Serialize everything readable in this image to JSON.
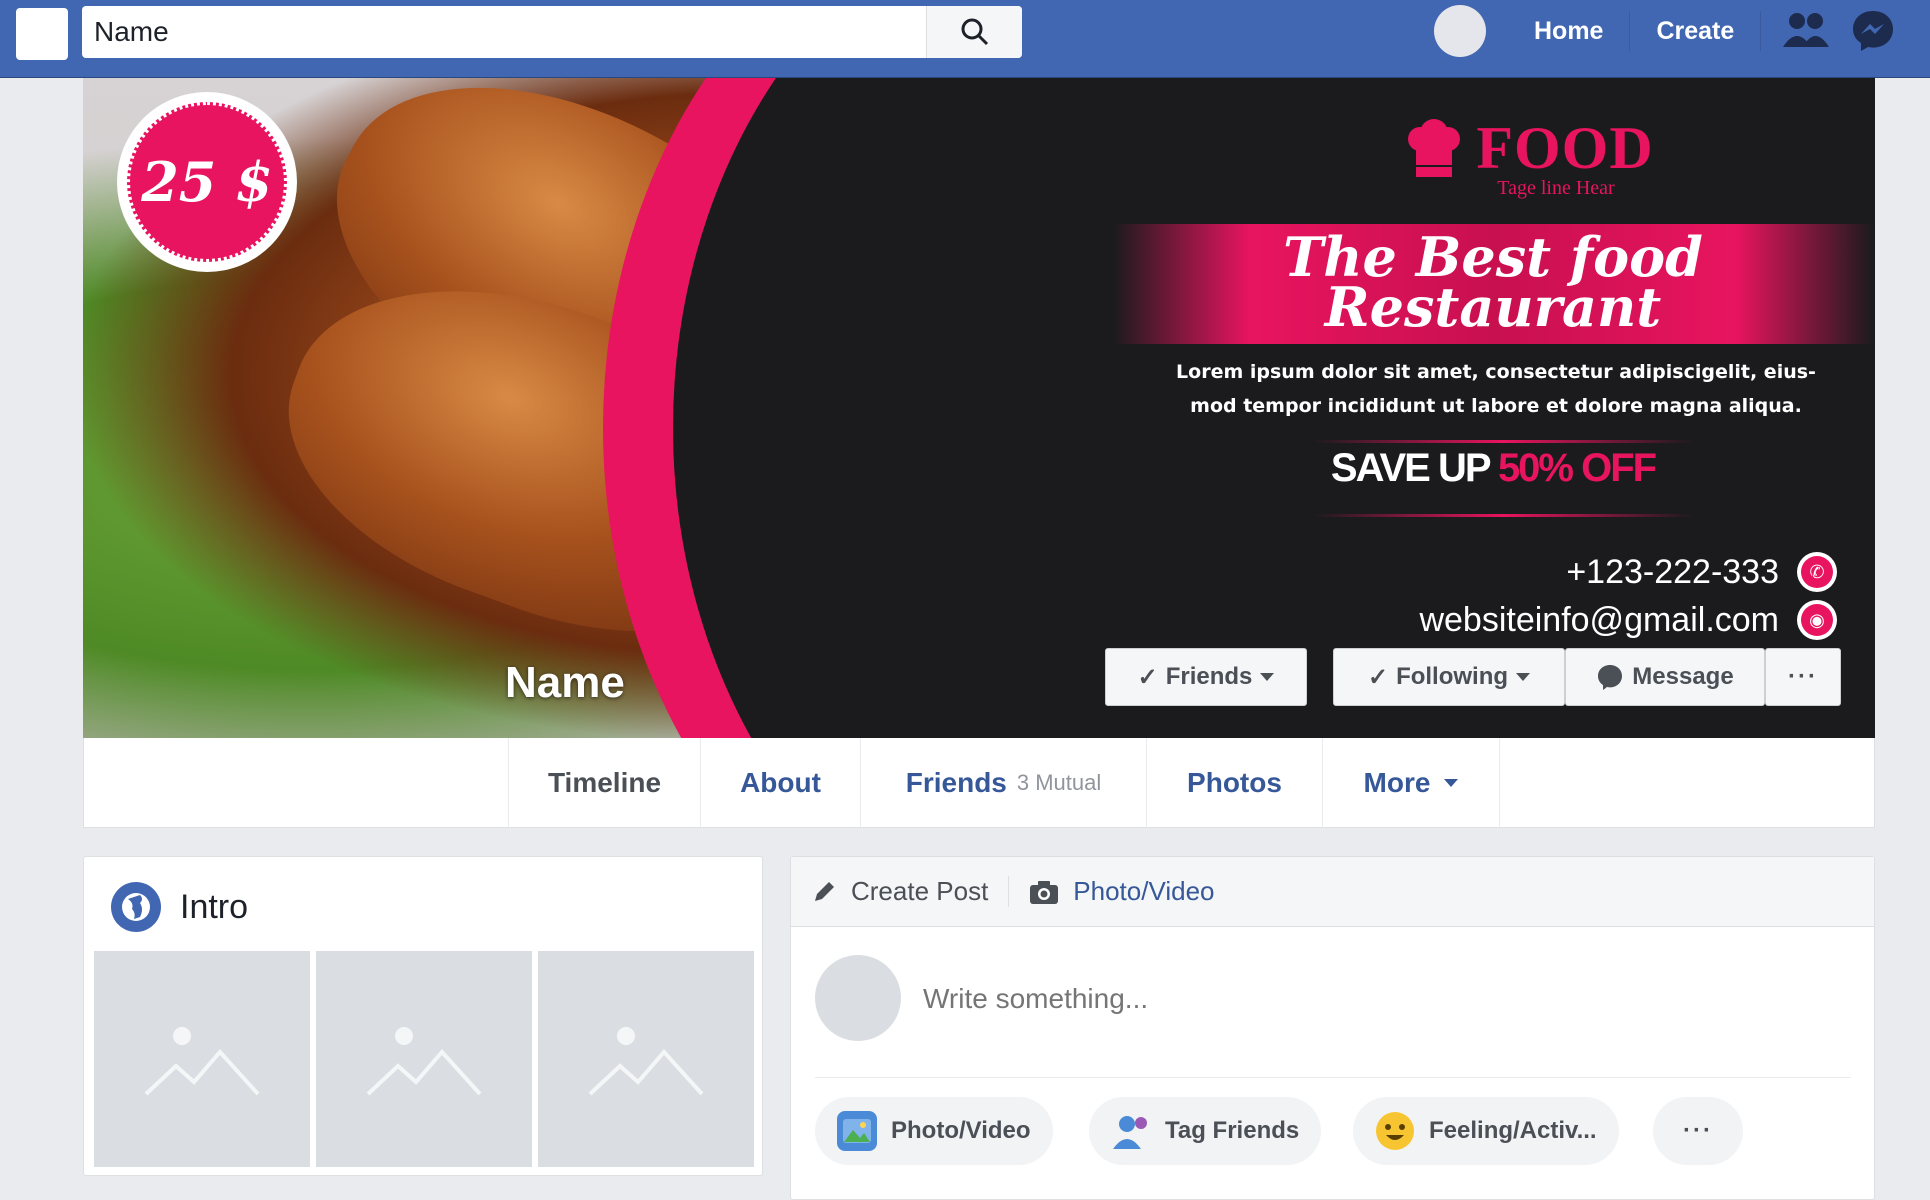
{
  "topbar": {
    "search_value": "Name",
    "nav": {
      "home": "Home",
      "create": "Create"
    },
    "icons": [
      "search-icon",
      "friends-icon",
      "messenger-icon"
    ]
  },
  "cover": {
    "price": "25 $",
    "brand_name": "FOOD",
    "brand_tagline": "Tage line Hear",
    "headline_line1": "The Best food",
    "headline_line2": "Restaurant",
    "body_line1": "Lorem ipsum dolor sit amet, consectetur adipiscigelit,  eius-",
    "body_line2": "mod tempor incididunt ut labore et dolore magna aliqua.",
    "save_prefix": "SAVE UP ",
    "save_highlight": "50% OFF",
    "phone": "+123-222-333",
    "website": "websiteinfo@gmail.com",
    "profile_name": "Name",
    "colors": {
      "accent": "#e8145f",
      "dark": "#1b1b1d"
    }
  },
  "actions": {
    "friends": "Friends",
    "following": "Following",
    "message": "Message",
    "more": "···"
  },
  "tabs": {
    "timeline": "Timeline",
    "about": "About",
    "friends": "Friends",
    "friends_sub": "3 Mutual",
    "photos": "Photos",
    "more": "More"
  },
  "intro": {
    "title": "Intro"
  },
  "composer": {
    "create_post": "Create Post",
    "photo_video_tab": "Photo/Video",
    "placeholder": "Write something...",
    "actions": {
      "photo_video": "Photo/Video",
      "tag_friends": "Tag Friends",
      "feeling": "Feeling/Activ...",
      "more": "···"
    }
  },
  "brand_color": "#4267b2"
}
